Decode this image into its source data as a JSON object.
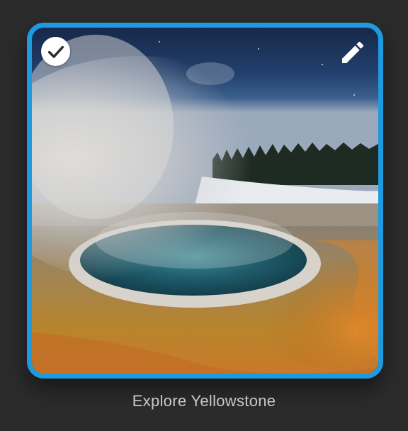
{
  "tile": {
    "caption": "Explore Yellowstone",
    "selected": true,
    "image_description_icon": "photo",
    "accent_color": "#1e9ae0",
    "check_icon": "check-circle-icon",
    "edit_icon": "pencil-icon"
  }
}
